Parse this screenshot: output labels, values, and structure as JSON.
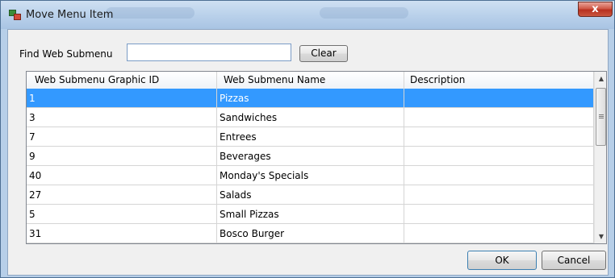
{
  "window": {
    "title": "Move Menu Item",
    "close_glyph": "x"
  },
  "find": {
    "label": "Find Web Submenu",
    "value": "",
    "placeholder": ""
  },
  "buttons": {
    "clear": "Clear",
    "ok": "OK",
    "cancel": "Cancel"
  },
  "table": {
    "columns": [
      "Web Submenu Graphic ID",
      "Web Submenu Name",
      "Description"
    ],
    "rows": [
      {
        "id": "1",
        "name": "Pizzas",
        "description": "",
        "selected": true
      },
      {
        "id": "3",
        "name": "Sandwiches",
        "description": ""
      },
      {
        "id": "7",
        "name": "Entrees",
        "description": ""
      },
      {
        "id": "9",
        "name": "Beverages",
        "description": ""
      },
      {
        "id": "40",
        "name": "Monday's Specials",
        "description": ""
      },
      {
        "id": "27",
        "name": "Salads",
        "description": ""
      },
      {
        "id": "5",
        "name": "Small Pizzas",
        "description": ""
      },
      {
        "id": "31",
        "name": "Bosco Burger",
        "description": ""
      }
    ]
  },
  "icons": [
    "app-icon",
    "close-icon",
    "scroll-up-icon",
    "scroll-down-icon"
  ],
  "colors": {
    "selection": "#3399ff",
    "titlebar": "#b8d0ea",
    "close": "#c9563f"
  }
}
